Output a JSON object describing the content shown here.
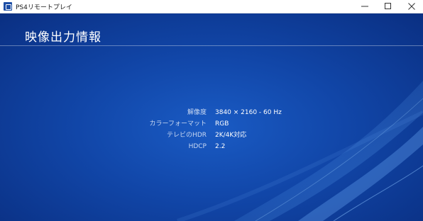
{
  "window": {
    "title": "PS4リモートプレイ",
    "minimize_glyph": "─",
    "maximize_glyph": "☐",
    "close_glyph": "✕"
  },
  "page": {
    "title": "映像出力情報"
  },
  "info": [
    {
      "label": "解像度",
      "value": "3840 × 2160 - 60 Hz"
    },
    {
      "label": "カラーフォーマット",
      "value": "RGB"
    },
    {
      "label": "テレビのHDR",
      "value": "2K/4K対応"
    },
    {
      "label": "HDCP",
      "value": "2.2"
    }
  ],
  "colors": {
    "background": "#1146a8",
    "accent": "#1e4fa6"
  }
}
